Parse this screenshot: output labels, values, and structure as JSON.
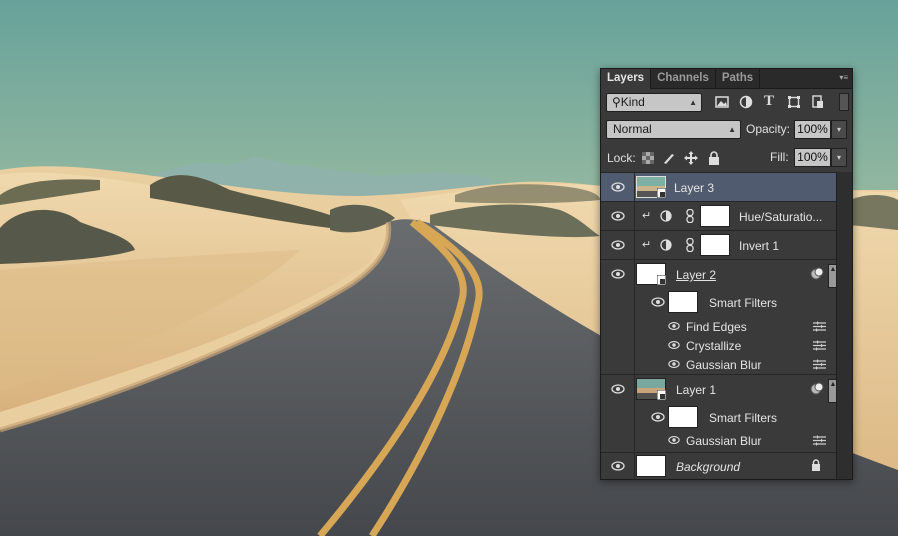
{
  "panel": {
    "tabs": [
      {
        "label": "Layers",
        "active": true
      },
      {
        "label": "Channels",
        "active": false
      },
      {
        "label": "Paths",
        "active": false
      }
    ],
    "filter": {
      "label": "Kind",
      "icons": [
        "image-filter-icon",
        "adjustment-filter-icon",
        "type-filter-icon",
        "shape-filter-icon",
        "smart-object-filter-icon"
      ]
    },
    "blend_mode": "Normal",
    "opacity_label": "Opacity:",
    "opacity_value": "100%",
    "lock_label": "Lock:",
    "fill_label": "Fill:",
    "fill_value": "100%"
  },
  "layers": [
    {
      "name": "Layer 3",
      "selected": true
    },
    {
      "name": "Hue/Saturatio..."
    },
    {
      "name": "Invert 1"
    },
    {
      "name": "Layer 2"
    },
    {
      "name": "Smart Filters"
    },
    {
      "name": "Find Edges"
    },
    {
      "name": "Crystallize"
    },
    {
      "name": "Gaussian Blur"
    },
    {
      "name": "Layer 1"
    },
    {
      "name": "Smart Filters"
    },
    {
      "name": "Gaussian Blur"
    },
    {
      "name": "Background"
    }
  ],
  "colors": {
    "selected_row": "#515b6f",
    "panel_bg": "#3a3a3a",
    "sky_top": "#6fa39b",
    "sky_bottom": "#d4dcb5",
    "sand": "#e6c79a",
    "road": "#4b4e52",
    "road_line": "#d9a955"
  }
}
